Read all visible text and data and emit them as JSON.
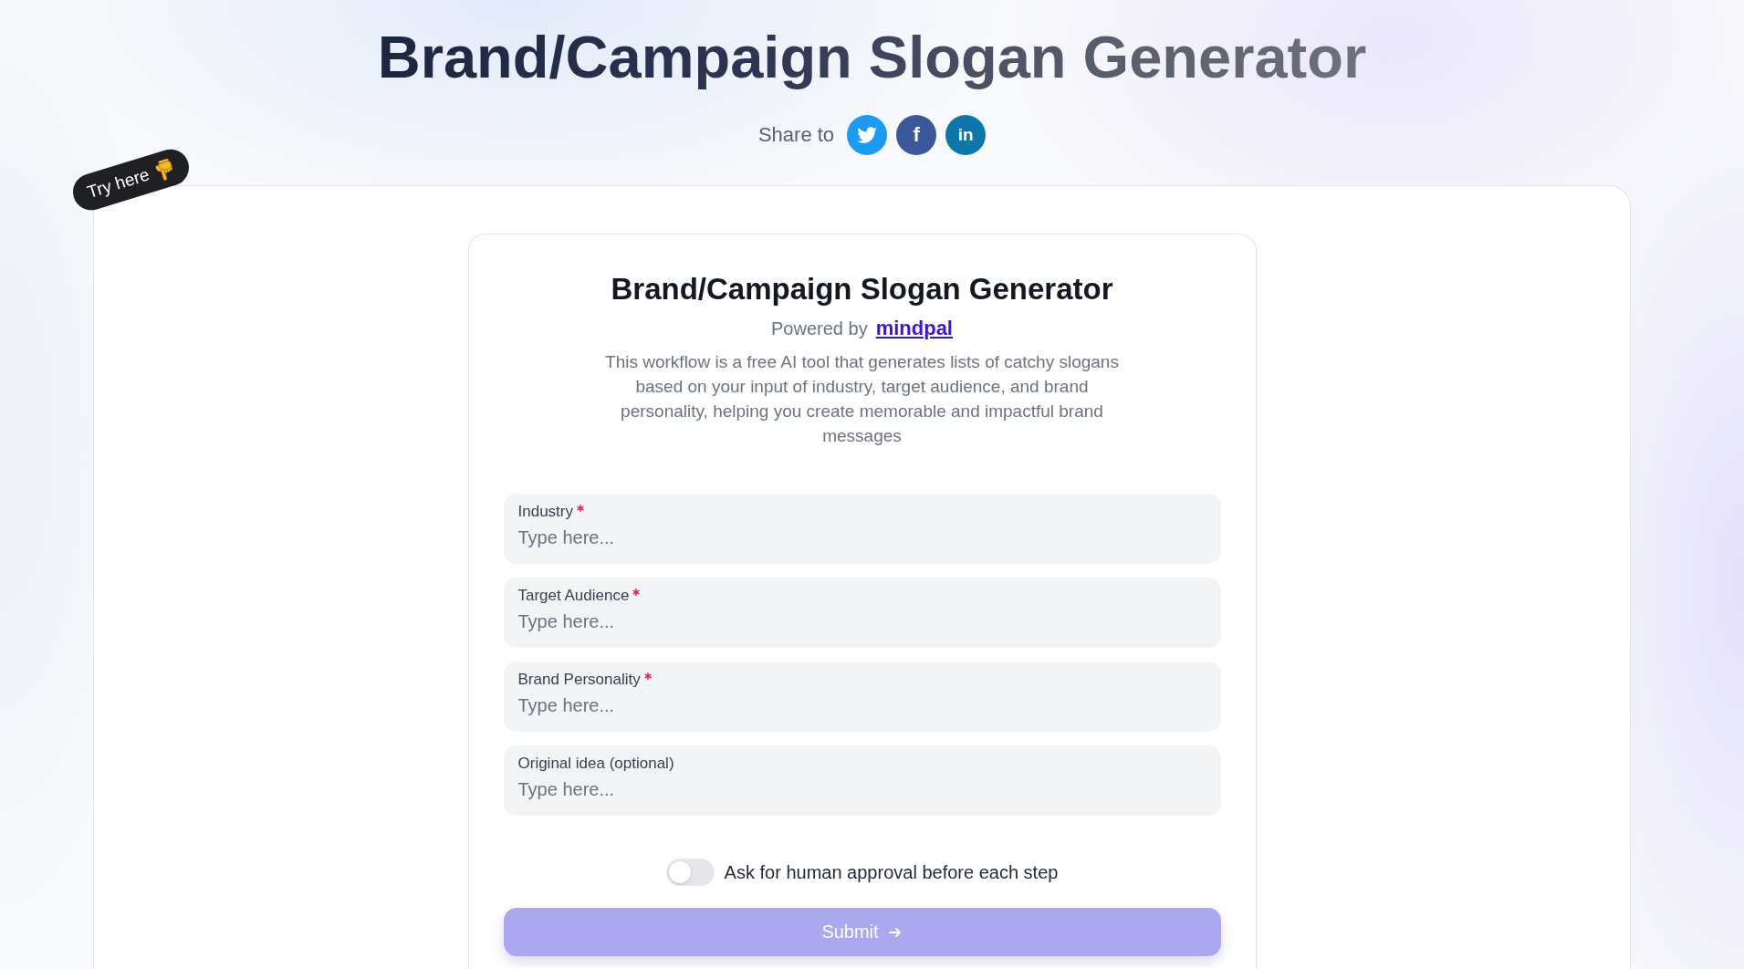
{
  "header": {
    "title": "Brand/Campaign Slogan Generator",
    "share_label": "Share to",
    "share_buttons": [
      {
        "kind": "bird",
        "color": "#1d9bf0"
      },
      {
        "kind": "letter",
        "glyph": "f",
        "color": "#3b5998"
      },
      {
        "kind": "letter",
        "glyph": "in",
        "color": "#0e76a8"
      }
    ]
  },
  "badge": {
    "label": "Try here"
  },
  "form": {
    "title": "Brand/Campaign Slogan Generator",
    "powered_by": {
      "label": "Powered by",
      "link": "mindpal"
    },
    "description": "This workflow is a free AI tool that generates lists of catchy slogans based on your input of industry, target audience, and brand personality, helping you create memorable and impactful brand messages",
    "fields": [
      {
        "label": "Industry",
        "required": true,
        "placeholder": "Type here..."
      },
      {
        "label": "Target Audience",
        "required": true,
        "placeholder": "Type here..."
      },
      {
        "label": "Brand Personality",
        "required": true,
        "placeholder": "Type here..."
      },
      {
        "label": "Original idea (optional)",
        "required": false,
        "placeholder": "Type here..."
      }
    ],
    "approval_toggle": {
      "label": "Ask for human approval before each step",
      "on": false
    },
    "submit": {
      "label": "Submit",
      "disabled": true
    }
  }
}
